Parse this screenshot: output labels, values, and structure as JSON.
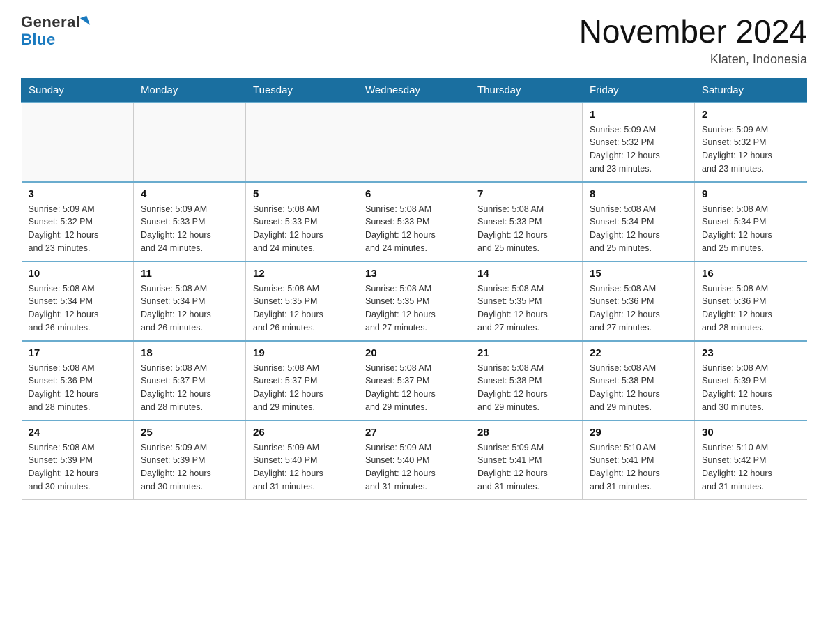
{
  "logo": {
    "general": "General",
    "blue": "Blue"
  },
  "title": "November 2024",
  "location": "Klaten, Indonesia",
  "days_of_week": [
    "Sunday",
    "Monday",
    "Tuesday",
    "Wednesday",
    "Thursday",
    "Friday",
    "Saturday"
  ],
  "weeks": [
    [
      {
        "day": "",
        "info": ""
      },
      {
        "day": "",
        "info": ""
      },
      {
        "day": "",
        "info": ""
      },
      {
        "day": "",
        "info": ""
      },
      {
        "day": "",
        "info": ""
      },
      {
        "day": "1",
        "info": "Sunrise: 5:09 AM\nSunset: 5:32 PM\nDaylight: 12 hours\nand 23 minutes."
      },
      {
        "day": "2",
        "info": "Sunrise: 5:09 AM\nSunset: 5:32 PM\nDaylight: 12 hours\nand 23 minutes."
      }
    ],
    [
      {
        "day": "3",
        "info": "Sunrise: 5:09 AM\nSunset: 5:32 PM\nDaylight: 12 hours\nand 23 minutes."
      },
      {
        "day": "4",
        "info": "Sunrise: 5:09 AM\nSunset: 5:33 PM\nDaylight: 12 hours\nand 24 minutes."
      },
      {
        "day": "5",
        "info": "Sunrise: 5:08 AM\nSunset: 5:33 PM\nDaylight: 12 hours\nand 24 minutes."
      },
      {
        "day": "6",
        "info": "Sunrise: 5:08 AM\nSunset: 5:33 PM\nDaylight: 12 hours\nand 24 minutes."
      },
      {
        "day": "7",
        "info": "Sunrise: 5:08 AM\nSunset: 5:33 PM\nDaylight: 12 hours\nand 25 minutes."
      },
      {
        "day": "8",
        "info": "Sunrise: 5:08 AM\nSunset: 5:34 PM\nDaylight: 12 hours\nand 25 minutes."
      },
      {
        "day": "9",
        "info": "Sunrise: 5:08 AM\nSunset: 5:34 PM\nDaylight: 12 hours\nand 25 minutes."
      }
    ],
    [
      {
        "day": "10",
        "info": "Sunrise: 5:08 AM\nSunset: 5:34 PM\nDaylight: 12 hours\nand 26 minutes."
      },
      {
        "day": "11",
        "info": "Sunrise: 5:08 AM\nSunset: 5:34 PM\nDaylight: 12 hours\nand 26 minutes."
      },
      {
        "day": "12",
        "info": "Sunrise: 5:08 AM\nSunset: 5:35 PM\nDaylight: 12 hours\nand 26 minutes."
      },
      {
        "day": "13",
        "info": "Sunrise: 5:08 AM\nSunset: 5:35 PM\nDaylight: 12 hours\nand 27 minutes."
      },
      {
        "day": "14",
        "info": "Sunrise: 5:08 AM\nSunset: 5:35 PM\nDaylight: 12 hours\nand 27 minutes."
      },
      {
        "day": "15",
        "info": "Sunrise: 5:08 AM\nSunset: 5:36 PM\nDaylight: 12 hours\nand 27 minutes."
      },
      {
        "day": "16",
        "info": "Sunrise: 5:08 AM\nSunset: 5:36 PM\nDaylight: 12 hours\nand 28 minutes."
      }
    ],
    [
      {
        "day": "17",
        "info": "Sunrise: 5:08 AM\nSunset: 5:36 PM\nDaylight: 12 hours\nand 28 minutes."
      },
      {
        "day": "18",
        "info": "Sunrise: 5:08 AM\nSunset: 5:37 PM\nDaylight: 12 hours\nand 28 minutes."
      },
      {
        "day": "19",
        "info": "Sunrise: 5:08 AM\nSunset: 5:37 PM\nDaylight: 12 hours\nand 29 minutes."
      },
      {
        "day": "20",
        "info": "Sunrise: 5:08 AM\nSunset: 5:37 PM\nDaylight: 12 hours\nand 29 minutes."
      },
      {
        "day": "21",
        "info": "Sunrise: 5:08 AM\nSunset: 5:38 PM\nDaylight: 12 hours\nand 29 minutes."
      },
      {
        "day": "22",
        "info": "Sunrise: 5:08 AM\nSunset: 5:38 PM\nDaylight: 12 hours\nand 29 minutes."
      },
      {
        "day": "23",
        "info": "Sunrise: 5:08 AM\nSunset: 5:39 PM\nDaylight: 12 hours\nand 30 minutes."
      }
    ],
    [
      {
        "day": "24",
        "info": "Sunrise: 5:08 AM\nSunset: 5:39 PM\nDaylight: 12 hours\nand 30 minutes."
      },
      {
        "day": "25",
        "info": "Sunrise: 5:09 AM\nSunset: 5:39 PM\nDaylight: 12 hours\nand 30 minutes."
      },
      {
        "day": "26",
        "info": "Sunrise: 5:09 AM\nSunset: 5:40 PM\nDaylight: 12 hours\nand 31 minutes."
      },
      {
        "day": "27",
        "info": "Sunrise: 5:09 AM\nSunset: 5:40 PM\nDaylight: 12 hours\nand 31 minutes."
      },
      {
        "day": "28",
        "info": "Sunrise: 5:09 AM\nSunset: 5:41 PM\nDaylight: 12 hours\nand 31 minutes."
      },
      {
        "day": "29",
        "info": "Sunrise: 5:10 AM\nSunset: 5:41 PM\nDaylight: 12 hours\nand 31 minutes."
      },
      {
        "day": "30",
        "info": "Sunrise: 5:10 AM\nSunset: 5:42 PM\nDaylight: 12 hours\nand 31 minutes."
      }
    ]
  ]
}
